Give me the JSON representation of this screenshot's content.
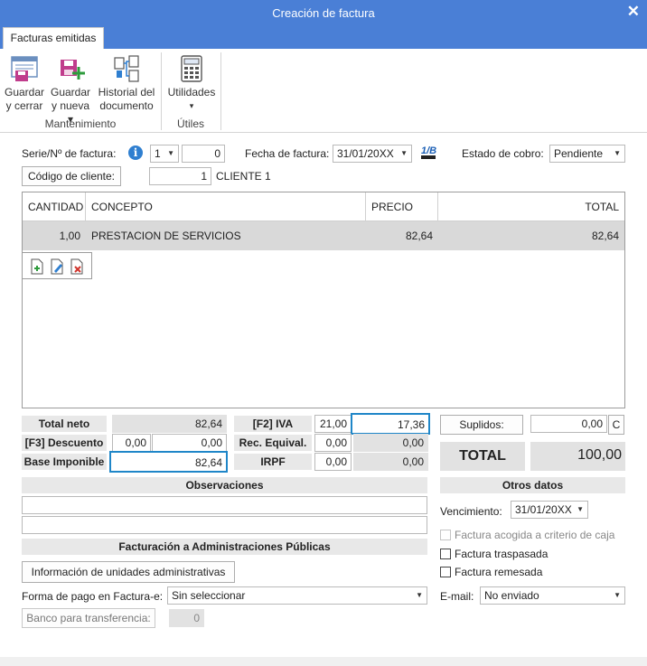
{
  "window": {
    "title": "Creación de factura"
  },
  "ribbon": {
    "tab": "Facturas emitidas",
    "buttons": {
      "guardar_cerrar": [
        "Guardar",
        "y cerrar"
      ],
      "guardar_nueva": [
        "Guardar",
        "y nueva ▾"
      ],
      "historial": [
        "Historial del",
        "documento"
      ],
      "utilidades": [
        "Utilidades",
        "▾"
      ]
    },
    "groups": {
      "mantenimiento": "Mantenimiento",
      "utiles": "Útiles"
    }
  },
  "form": {
    "serie_label": "Serie/Nº de factura:",
    "serie_value": "1",
    "numero_value": "0",
    "fecha_label": "Fecha de factura:",
    "fecha_value": "31/01/20XX",
    "estado_label": "Estado de cobro:",
    "estado_value": "Pendiente",
    "codigo_cliente_button": "Código de cliente:",
    "codigo_cliente_value": "1",
    "cliente_name": "CLIENTE 1"
  },
  "lines_table": {
    "columns": [
      "CANTIDAD",
      "CONCEPTO",
      "PRECIO UD.",
      "TOTAL"
    ],
    "rows": [
      {
        "cantidad": "1,00",
        "concepto": "PRESTACION DE SERVICIOS",
        "precio": "82,64",
        "total": "82,64"
      }
    ]
  },
  "totals": {
    "total_neto_label": "Total neto",
    "total_neto": "82,64",
    "descuento_label": "[F3] Descuento",
    "descuento_pct": "0,00",
    "descuento_value": "0,00",
    "base_label": "Base Imponible",
    "base_value": "82,64",
    "iva_label": "[F2] IVA",
    "iva_pct": "21,00",
    "iva_value": "17,36",
    "recargo_label": "Rec. Equival.",
    "recargo_pct": "0,00",
    "recargo_value": "0,00",
    "irpf_label": "IRPF",
    "irpf_pct": "0,00",
    "irpf_value": "0,00",
    "suplidos_button": "Suplidos:",
    "suplidos_value": "0,00",
    "suplidos_c": "C",
    "total_label": "TOTAL",
    "total_value": "100,00"
  },
  "observaciones": {
    "title": "Observaciones"
  },
  "otros_datos": {
    "title": "Otros datos",
    "vencimiento_label": "Vencimiento:",
    "vencimiento_value": "31/01/20XX",
    "caja_label": "Factura acogida a criterio de caja",
    "traspasada_label": "Factura traspasada",
    "remesada_label": "Factura remesada",
    "email_label": "E-mail:",
    "email_value": "No enviado"
  },
  "admin_publicas": {
    "title": "Facturación a Administraciones Públicas",
    "info_button": "Información de unidades administrativas",
    "forma_pago_label": "Forma de pago en Factura-e:",
    "forma_pago_value": "Sin seleccionar",
    "banco_button": "Banco para transferencia:",
    "banco_value": "0"
  },
  "colors": {
    "accent": "#4a7fd6",
    "highlight_border": "#1f86c8"
  },
  "icons": [
    "save-close-icon",
    "save-new-icon",
    "history-icon",
    "calculator-icon",
    "info-icon",
    "calendar-icon",
    "new-line-icon",
    "edit-line-icon",
    "delete-line-icon"
  ]
}
